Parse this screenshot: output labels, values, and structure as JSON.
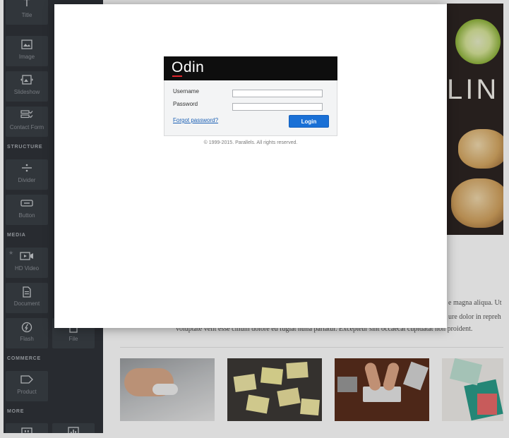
{
  "sidebar": {
    "sections": {
      "structure": "STRUCTURE",
      "media": "MEDIA",
      "commerce": "COMMERCE",
      "more": "MORE"
    },
    "widgets": {
      "title": "Title",
      "image": "Image",
      "slideshow": "Slideshow",
      "contact_form": "Contact Form",
      "divider": "Divider",
      "button": "Button",
      "hd_video": "HD Video",
      "document": "Document",
      "flash": "Flash",
      "file": "File",
      "product": "Product"
    },
    "icons": [
      "title-icon",
      "image-icon",
      "slideshow-icon",
      "contact-form-icon",
      "divider-icon",
      "button-icon",
      "hd-video-icon",
      "document-icon",
      "flash-icon",
      "product-icon",
      "quote-icon",
      "chart-icon"
    ]
  },
  "preview": {
    "hero_title": "LIN",
    "text_line_1": "e magna aliqua. Ut e",
    "text_line_2": "ure dolor in repreh",
    "text_line_3": "voluptate velit esse cillum dolore eu fugiat nulla pariatur. Excepteur sint occaecat cupidatat non proident."
  },
  "login": {
    "logo": "Odin",
    "username_label": "Username",
    "password_label": "Password",
    "username_value": "",
    "password_value": "",
    "forgot_link": "Forgot password?",
    "login_button": "Login",
    "copyright": "© 1999-2015. Parallels. All rights reserved."
  },
  "colors": {
    "sidebar_bg": "#2f3338",
    "header_bg": "#0e0e0e",
    "logo_accent": "#e0262d",
    "button_blue": "#1a70d6",
    "link_blue": "#1a5fb4"
  }
}
